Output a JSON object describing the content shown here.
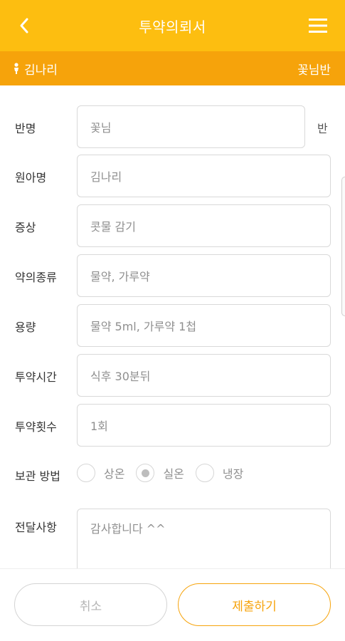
{
  "header": {
    "title": "투약의뢰서",
    "back_icon": "chevron-left-icon",
    "menu_icon": "hamburger-menu-icon",
    "color": "#FDBE10"
  },
  "subbar": {
    "child_icon": "person-icon",
    "child_name": "김나리",
    "class_name": "꽃님반",
    "color": "#F6A30B"
  },
  "form": {
    "class": {
      "label": "반명",
      "value": "꽃님",
      "suffix": "반"
    },
    "child": {
      "label": "원아명",
      "value": "김나리"
    },
    "symptom": {
      "label": "증상",
      "value": "콧물 감기"
    },
    "med_type": {
      "label": "약의종류",
      "value": "물약, 가루약"
    },
    "dosage": {
      "label": "용량",
      "value": "물약 5ml, 가루약 1첩"
    },
    "time": {
      "label": "투약시간",
      "value": "식후 30분뒤"
    },
    "count": {
      "label": "투약횟수",
      "value": "1회"
    },
    "storage": {
      "label": "보관 방법",
      "options": [
        "상온",
        "실온",
        "냉장"
      ],
      "selected": "실온"
    },
    "memo": {
      "label": "전달사항",
      "value": "감사합니다 ^^"
    }
  },
  "buttons": {
    "cancel": "취소",
    "submit": "제출하기",
    "accent": "#F6A30B"
  }
}
